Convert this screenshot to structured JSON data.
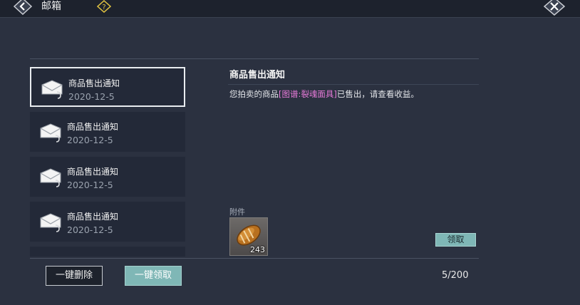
{
  "header": {
    "title": "邮箱",
    "back_icon": "chevron-left-icon",
    "help_icon": "question-icon",
    "close_icon": "close-icon"
  },
  "mail_list": {
    "items": [
      {
        "name": "商品售出通知",
        "date": "2020-12-5",
        "selected": true
      },
      {
        "name": "商品售出通知",
        "date": "2020-12-5",
        "selected": false
      },
      {
        "name": "商品售出通知",
        "date": "2020-12-5",
        "selected": false
      },
      {
        "name": "商品售出通知",
        "date": "2020-12-5",
        "selected": false
      }
    ]
  },
  "detail": {
    "title": "商品售出通知",
    "body_prefix": "您拍卖的商品",
    "body_item": "[图谱:裂魂面具]",
    "body_suffix": "已售出，请查看收益。",
    "attachment_label": "附件",
    "attachment": {
      "icon": "bread-icon",
      "quantity": "243"
    },
    "claim_label": "领取"
  },
  "footer": {
    "delete_all_label": "一键删除",
    "claim_all_label": "一键领取",
    "count": "5/200"
  },
  "colors": {
    "background": "#2b3140",
    "accent_teal": "#7fb7b6",
    "highlight_pink": "#e67ad8"
  }
}
